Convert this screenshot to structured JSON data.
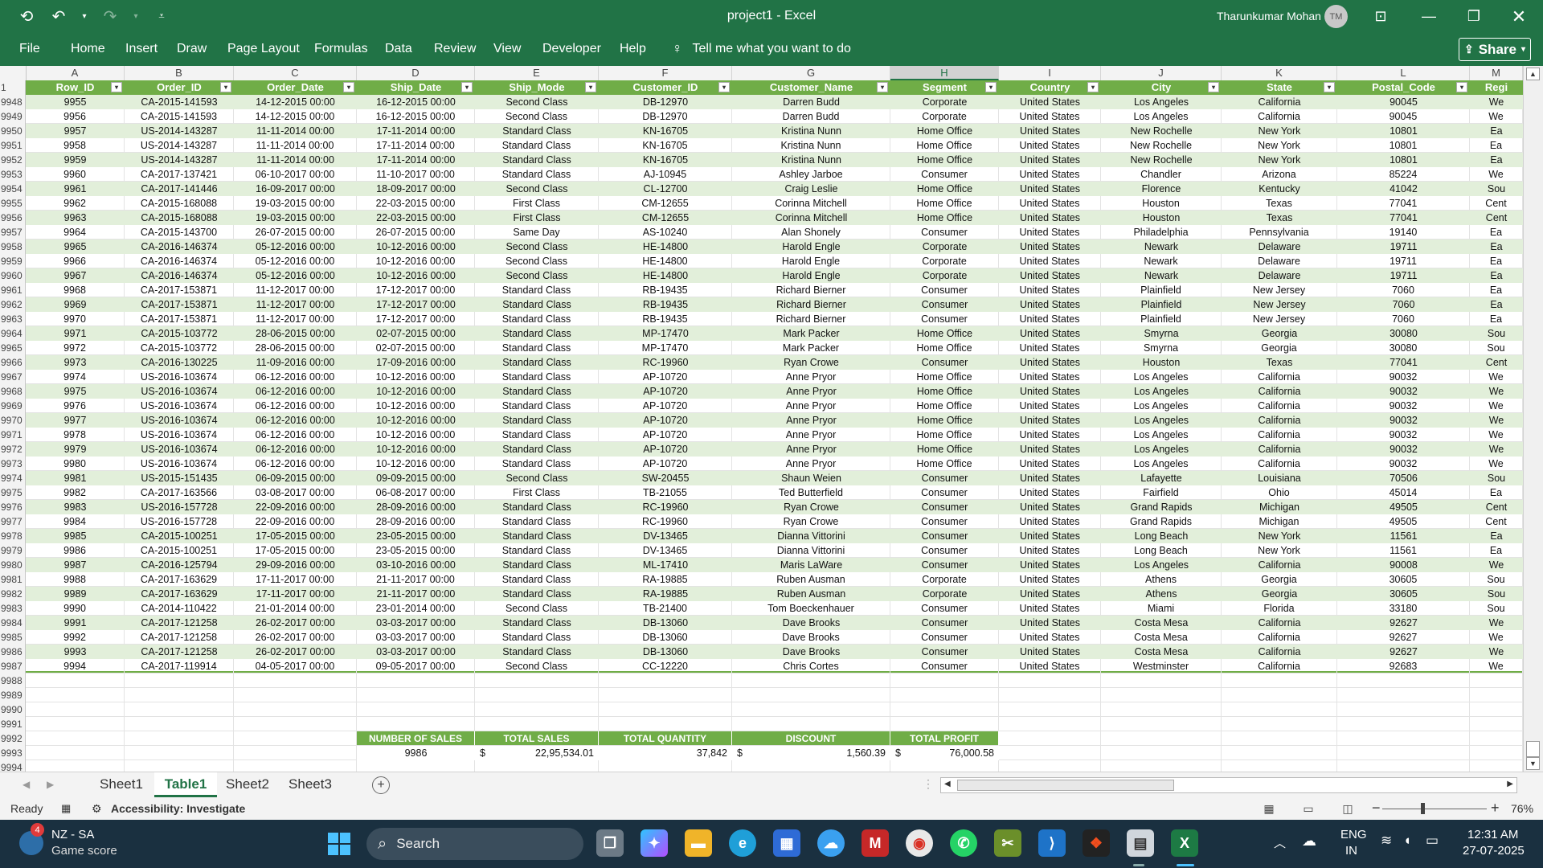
{
  "window": {
    "title": "project1  -  Excel",
    "user": "Tharunkumar Mohan",
    "avatar_initials": "TM"
  },
  "ribbon": {
    "tabs": [
      "File",
      "Home",
      "Insert",
      "Draw",
      "Page Layout",
      "Formulas",
      "Data",
      "Review",
      "View",
      "Developer",
      "Help"
    ],
    "tell_me": "Tell me what you want to do",
    "share": "Share"
  },
  "grid": {
    "columns": [
      "A",
      "B",
      "C",
      "D",
      "E",
      "F",
      "G",
      "H",
      "I",
      "J",
      "K",
      "L",
      "M"
    ],
    "selected_column": "H",
    "headers": [
      "Row_ID",
      "Order_ID",
      "Order_Date",
      "Ship_Date",
      "Ship_Mode",
      "Customer_ID",
      "Customer_Name",
      "Segment",
      "Country",
      "City",
      "State",
      "Postal_Code",
      "Regi"
    ],
    "header_row_number": "1",
    "rows": [
      {
        "n": "9948",
        "v": [
          "9955",
          "CA-2015-141593",
          "14-12-2015 00:00",
          "16-12-2015 00:00",
          "Second Class",
          "DB-12970",
          "Darren Budd",
          "Corporate",
          "United States",
          "Los Angeles",
          "California",
          "90045",
          "We"
        ]
      },
      {
        "n": "9949",
        "v": [
          "9956",
          "CA-2015-141593",
          "14-12-2015 00:00",
          "16-12-2015 00:00",
          "Second Class",
          "DB-12970",
          "Darren Budd",
          "Corporate",
          "United States",
          "Los Angeles",
          "California",
          "90045",
          "We"
        ]
      },
      {
        "n": "9950",
        "v": [
          "9957",
          "US-2014-143287",
          "11-11-2014 00:00",
          "17-11-2014 00:00",
          "Standard Class",
          "KN-16705",
          "Kristina Nunn",
          "Home Office",
          "United States",
          "New Rochelle",
          "New York",
          "10801",
          "Ea"
        ]
      },
      {
        "n": "9951",
        "v": [
          "9958",
          "US-2014-143287",
          "11-11-2014 00:00",
          "17-11-2014 00:00",
          "Standard Class",
          "KN-16705",
          "Kristina Nunn",
          "Home Office",
          "United States",
          "New Rochelle",
          "New York",
          "10801",
          "Ea"
        ]
      },
      {
        "n": "9952",
        "v": [
          "9959",
          "US-2014-143287",
          "11-11-2014 00:00",
          "17-11-2014 00:00",
          "Standard Class",
          "KN-16705",
          "Kristina Nunn",
          "Home Office",
          "United States",
          "New Rochelle",
          "New York",
          "10801",
          "Ea"
        ]
      },
      {
        "n": "9953",
        "v": [
          "9960",
          "CA-2017-137421",
          "06-10-2017 00:00",
          "11-10-2017 00:00",
          "Standard Class",
          "AJ-10945",
          "Ashley Jarboe",
          "Consumer",
          "United States",
          "Chandler",
          "Arizona",
          "85224",
          "We"
        ]
      },
      {
        "n": "9954",
        "v": [
          "9961",
          "CA-2017-141446",
          "16-09-2017 00:00",
          "18-09-2017 00:00",
          "Second Class",
          "CL-12700",
          "Craig Leslie",
          "Home Office",
          "United States",
          "Florence",
          "Kentucky",
          "41042",
          "Sou"
        ]
      },
      {
        "n": "9955",
        "v": [
          "9962",
          "CA-2015-168088",
          "19-03-2015 00:00",
          "22-03-2015 00:00",
          "First Class",
          "CM-12655",
          "Corinna Mitchell",
          "Home Office",
          "United States",
          "Houston",
          "Texas",
          "77041",
          "Cent"
        ]
      },
      {
        "n": "9956",
        "v": [
          "9963",
          "CA-2015-168088",
          "19-03-2015 00:00",
          "22-03-2015 00:00",
          "First Class",
          "CM-12655",
          "Corinna Mitchell",
          "Home Office",
          "United States",
          "Houston",
          "Texas",
          "77041",
          "Cent"
        ]
      },
      {
        "n": "9957",
        "v": [
          "9964",
          "CA-2015-143700",
          "26-07-2015 00:00",
          "26-07-2015 00:00",
          "Same Day",
          "AS-10240",
          "Alan Shonely",
          "Consumer",
          "United States",
          "Philadelphia",
          "Pennsylvania",
          "19140",
          "Ea"
        ]
      },
      {
        "n": "9958",
        "v": [
          "9965",
          "CA-2016-146374",
          "05-12-2016 00:00",
          "10-12-2016 00:00",
          "Second Class",
          "HE-14800",
          "Harold Engle",
          "Corporate",
          "United States",
          "Newark",
          "Delaware",
          "19711",
          "Ea"
        ]
      },
      {
        "n": "9959",
        "v": [
          "9966",
          "CA-2016-146374",
          "05-12-2016 00:00",
          "10-12-2016 00:00",
          "Second Class",
          "HE-14800",
          "Harold Engle",
          "Corporate",
          "United States",
          "Newark",
          "Delaware",
          "19711",
          "Ea"
        ]
      },
      {
        "n": "9960",
        "v": [
          "9967",
          "CA-2016-146374",
          "05-12-2016 00:00",
          "10-12-2016 00:00",
          "Second Class",
          "HE-14800",
          "Harold Engle",
          "Corporate",
          "United States",
          "Newark",
          "Delaware",
          "19711",
          "Ea"
        ]
      },
      {
        "n": "9961",
        "v": [
          "9968",
          "CA-2017-153871",
          "11-12-2017 00:00",
          "17-12-2017 00:00",
          "Standard Class",
          "RB-19435",
          "Richard Bierner",
          "Consumer",
          "United States",
          "Plainfield",
          "New Jersey",
          "7060",
          "Ea"
        ]
      },
      {
        "n": "9962",
        "v": [
          "9969",
          "CA-2017-153871",
          "11-12-2017 00:00",
          "17-12-2017 00:00",
          "Standard Class",
          "RB-19435",
          "Richard Bierner",
          "Consumer",
          "United States",
          "Plainfield",
          "New Jersey",
          "7060",
          "Ea"
        ]
      },
      {
        "n": "9963",
        "v": [
          "9970",
          "CA-2017-153871",
          "11-12-2017 00:00",
          "17-12-2017 00:00",
          "Standard Class",
          "RB-19435",
          "Richard Bierner",
          "Consumer",
          "United States",
          "Plainfield",
          "New Jersey",
          "7060",
          "Ea"
        ]
      },
      {
        "n": "9964",
        "v": [
          "9971",
          "CA-2015-103772",
          "28-06-2015 00:00",
          "02-07-2015 00:00",
          "Standard Class",
          "MP-17470",
          "Mark Packer",
          "Home Office",
          "United States",
          "Smyrna",
          "Georgia",
          "30080",
          "Sou"
        ]
      },
      {
        "n": "9965",
        "v": [
          "9972",
          "CA-2015-103772",
          "28-06-2015 00:00",
          "02-07-2015 00:00",
          "Standard Class",
          "MP-17470",
          "Mark Packer",
          "Home Office",
          "United States",
          "Smyrna",
          "Georgia",
          "30080",
          "Sou"
        ]
      },
      {
        "n": "9966",
        "v": [
          "9973",
          "CA-2016-130225",
          "11-09-2016 00:00",
          "17-09-2016 00:00",
          "Standard Class",
          "RC-19960",
          "Ryan Crowe",
          "Consumer",
          "United States",
          "Houston",
          "Texas",
          "77041",
          "Cent"
        ]
      },
      {
        "n": "9967",
        "v": [
          "9974",
          "US-2016-103674",
          "06-12-2016 00:00",
          "10-12-2016 00:00",
          "Standard Class",
          "AP-10720",
          "Anne Pryor",
          "Home Office",
          "United States",
          "Los Angeles",
          "California",
          "90032",
          "We"
        ]
      },
      {
        "n": "9968",
        "v": [
          "9975",
          "US-2016-103674",
          "06-12-2016 00:00",
          "10-12-2016 00:00",
          "Standard Class",
          "AP-10720",
          "Anne Pryor",
          "Home Office",
          "United States",
          "Los Angeles",
          "California",
          "90032",
          "We"
        ]
      },
      {
        "n": "9969",
        "v": [
          "9976",
          "US-2016-103674",
          "06-12-2016 00:00",
          "10-12-2016 00:00",
          "Standard Class",
          "AP-10720",
          "Anne Pryor",
          "Home Office",
          "United States",
          "Los Angeles",
          "California",
          "90032",
          "We"
        ]
      },
      {
        "n": "9970",
        "v": [
          "9977",
          "US-2016-103674",
          "06-12-2016 00:00",
          "10-12-2016 00:00",
          "Standard Class",
          "AP-10720",
          "Anne Pryor",
          "Home Office",
          "United States",
          "Los Angeles",
          "California",
          "90032",
          "We"
        ]
      },
      {
        "n": "9971",
        "v": [
          "9978",
          "US-2016-103674",
          "06-12-2016 00:00",
          "10-12-2016 00:00",
          "Standard Class",
          "AP-10720",
          "Anne Pryor",
          "Home Office",
          "United States",
          "Los Angeles",
          "California",
          "90032",
          "We"
        ]
      },
      {
        "n": "9972",
        "v": [
          "9979",
          "US-2016-103674",
          "06-12-2016 00:00",
          "10-12-2016 00:00",
          "Standard Class",
          "AP-10720",
          "Anne Pryor",
          "Home Office",
          "United States",
          "Los Angeles",
          "California",
          "90032",
          "We"
        ]
      },
      {
        "n": "9973",
        "v": [
          "9980",
          "US-2016-103674",
          "06-12-2016 00:00",
          "10-12-2016 00:00",
          "Standard Class",
          "AP-10720",
          "Anne Pryor",
          "Home Office",
          "United States",
          "Los Angeles",
          "California",
          "90032",
          "We"
        ]
      },
      {
        "n": "9974",
        "v": [
          "9981",
          "US-2015-151435",
          "06-09-2015 00:00",
          "09-09-2015 00:00",
          "Second Class",
          "SW-20455",
          "Shaun Weien",
          "Consumer",
          "United States",
          "Lafayette",
          "Louisiana",
          "70506",
          "Sou"
        ]
      },
      {
        "n": "9975",
        "v": [
          "9982",
          "CA-2017-163566",
          "03-08-2017 00:00",
          "06-08-2017 00:00",
          "First Class",
          "TB-21055",
          "Ted Butterfield",
          "Consumer",
          "United States",
          "Fairfield",
          "Ohio",
          "45014",
          "Ea"
        ]
      },
      {
        "n": "9976",
        "v": [
          "9983",
          "US-2016-157728",
          "22-09-2016 00:00",
          "28-09-2016 00:00",
          "Standard Class",
          "RC-19960",
          "Ryan Crowe",
          "Consumer",
          "United States",
          "Grand Rapids",
          "Michigan",
          "49505",
          "Cent"
        ]
      },
      {
        "n": "9977",
        "v": [
          "9984",
          "US-2016-157728",
          "22-09-2016 00:00",
          "28-09-2016 00:00",
          "Standard Class",
          "RC-19960",
          "Ryan Crowe",
          "Consumer",
          "United States",
          "Grand Rapids",
          "Michigan",
          "49505",
          "Cent"
        ]
      },
      {
        "n": "9978",
        "v": [
          "9985",
          "CA-2015-100251",
          "17-05-2015 00:00",
          "23-05-2015 00:00",
          "Standard Class",
          "DV-13465",
          "Dianna Vittorini",
          "Consumer",
          "United States",
          "Long Beach",
          "New York",
          "11561",
          "Ea"
        ]
      },
      {
        "n": "9979",
        "v": [
          "9986",
          "CA-2015-100251",
          "17-05-2015 00:00",
          "23-05-2015 00:00",
          "Standard Class",
          "DV-13465",
          "Dianna Vittorini",
          "Consumer",
          "United States",
          "Long Beach",
          "New York",
          "11561",
          "Ea"
        ]
      },
      {
        "n": "9980",
        "v": [
          "9987",
          "CA-2016-125794",
          "29-09-2016 00:00",
          "03-10-2016 00:00",
          "Standard Class",
          "ML-17410",
          "Maris LaWare",
          "Consumer",
          "United States",
          "Los Angeles",
          "California",
          "90008",
          "We"
        ]
      },
      {
        "n": "9981",
        "v": [
          "9988",
          "CA-2017-163629",
          "17-11-2017 00:00",
          "21-11-2017 00:00",
          "Standard Class",
          "RA-19885",
          "Ruben Ausman",
          "Corporate",
          "United States",
          "Athens",
          "Georgia",
          "30605",
          "Sou"
        ]
      },
      {
        "n": "9982",
        "v": [
          "9989",
          "CA-2017-163629",
          "17-11-2017 00:00",
          "21-11-2017 00:00",
          "Standard Class",
          "RA-19885",
          "Ruben Ausman",
          "Corporate",
          "United States",
          "Athens",
          "Georgia",
          "30605",
          "Sou"
        ]
      },
      {
        "n": "9983",
        "v": [
          "9990",
          "CA-2014-110422",
          "21-01-2014 00:00",
          "23-01-2014 00:00",
          "Second Class",
          "TB-21400",
          "Tom Boeckenhauer",
          "Consumer",
          "United States",
          "Miami",
          "Florida",
          "33180",
          "Sou"
        ]
      },
      {
        "n": "9984",
        "v": [
          "9991",
          "CA-2017-121258",
          "26-02-2017 00:00",
          "03-03-2017 00:00",
          "Standard Class",
          "DB-13060",
          "Dave Brooks",
          "Consumer",
          "United States",
          "Costa Mesa",
          "California",
          "92627",
          "We"
        ]
      },
      {
        "n": "9985",
        "v": [
          "9992",
          "CA-2017-121258",
          "26-02-2017 00:00",
          "03-03-2017 00:00",
          "Standard Class",
          "DB-13060",
          "Dave Brooks",
          "Consumer",
          "United States",
          "Costa Mesa",
          "California",
          "92627",
          "We"
        ]
      },
      {
        "n": "9986",
        "v": [
          "9993",
          "CA-2017-121258",
          "26-02-2017 00:00",
          "03-03-2017 00:00",
          "Standard Class",
          "DB-13060",
          "Dave Brooks",
          "Consumer",
          "United States",
          "Costa Mesa",
          "California",
          "92627",
          "We"
        ]
      },
      {
        "n": "9987",
        "v": [
          "9994",
          "CA-2017-119914",
          "04-05-2017 00:00",
          "09-05-2017 00:00",
          "Second Class",
          "CC-12220",
          "Chris Cortes",
          "Consumer",
          "United States",
          "Westminster",
          "California",
          "92683",
          "We"
        ]
      }
    ],
    "empty_rows": [
      "9988",
      "9989",
      "9990",
      "9991",
      "9992",
      "9993",
      "9994"
    ],
    "summary": {
      "labels": [
        "NUMBER OF SALES",
        "TOTAL SALES",
        "TOTAL QUANTITY",
        "DISCOUNT",
        "TOTAL PROFIT"
      ],
      "number_of_sales": "9986",
      "total_sales": "22,95,534.01",
      "total_quantity": "37,842",
      "discount": "1,560.39",
      "total_profit": "76,000.58",
      "currency": "$"
    }
  },
  "sheets": {
    "tabs": [
      "Sheet1",
      "Table1",
      "Sheet2",
      "Sheet3"
    ],
    "active": "Table1"
  },
  "status": {
    "ready": "Ready",
    "accessibility": "Accessibility: Investigate",
    "zoom": "76%"
  },
  "taskbar": {
    "score_line1": "NZ - SA",
    "score_line2": "Game score",
    "score_badge": "4",
    "search": "Search",
    "lang1": "ENG",
    "lang2": "IN",
    "time": "12:31 AM",
    "date": "27-07-2025"
  }
}
